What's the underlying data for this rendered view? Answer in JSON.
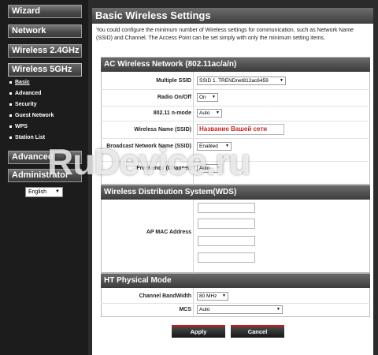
{
  "sidebar": {
    "main_items": [
      {
        "label": "Wizard"
      },
      {
        "label": "Network"
      },
      {
        "label": "Wireless 2.4GHz"
      },
      {
        "label": "Wireless 5GHz"
      },
      {
        "label": "Advanced"
      },
      {
        "label": "Administrator"
      }
    ],
    "sub_items": [
      {
        "label": "Basic"
      },
      {
        "label": "Advanced"
      },
      {
        "label": "Security"
      },
      {
        "label": "Guest Network"
      },
      {
        "label": "WPS"
      },
      {
        "label": "Station List"
      }
    ],
    "language": "English"
  },
  "page": {
    "title": "Basic Wireless Settings",
    "intro": "You could configure the minimum number of Wireless settings for communication, such as Network Name (SSID) and Channel. The Access Point can be set simply with only the minimum setting items."
  },
  "ac_section": {
    "title": "AC Wireless Network (802.11ac/a/n)",
    "multiple_ssid_label": "Multiple SSID",
    "multiple_ssid_value": "SSID 1. TRENDnet812ac6459",
    "radio_label": "Radio On/Off",
    "radio_value": "On",
    "nmode_label": "802.11 n-mode",
    "nmode_value": "Auto",
    "ssid_name_label": "Wireless Name (SSID)",
    "ssid_name_value": "Название Вашей сети",
    "broadcast_label": "Broadcast Network Name (SSID)",
    "broadcast_value": "Enabled",
    "frequency_label": "Frequency (Channel)",
    "frequency_value": "Auto"
  },
  "wds_section": {
    "title": "Wireless Distribution System(WDS)",
    "ap_mac_label": "AP MAC Address"
  },
  "ht_section": {
    "title": "HT Physical Mode",
    "bandwidth_label": "Channel BandWidth",
    "bandwidth_value": "80 MHz",
    "mcs_label": "MCS",
    "mcs_value": "Auto"
  },
  "buttons": {
    "apply": "Apply",
    "cancel": "Cancel"
  },
  "watermark": {
    "main": "RuDevice.ru",
    "corner": "RuDevice.ru"
  }
}
